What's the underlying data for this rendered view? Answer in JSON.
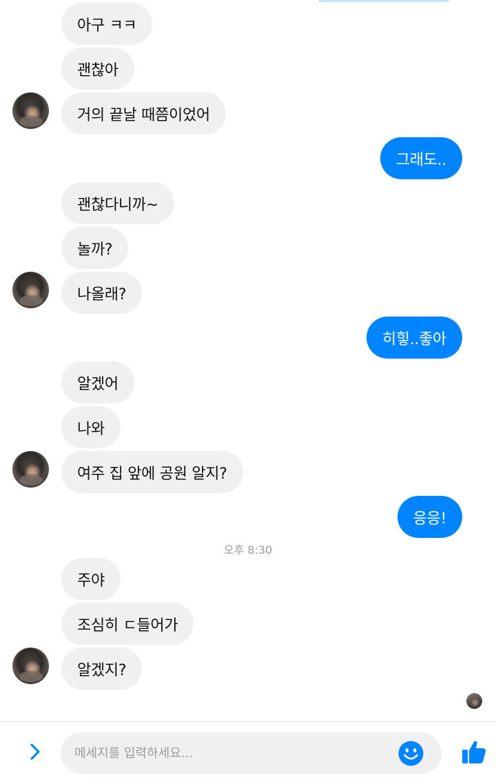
{
  "messages": [
    {
      "text": "아구 ㅋㅋ"
    },
    {
      "text": "괜찮아"
    },
    {
      "text": "거의 끝날 때쯤이었어"
    },
    {
      "text": "그래도.."
    },
    {
      "text": "괜찮다니까~"
    },
    {
      "text": "놀까?"
    },
    {
      "text": "나올래?"
    },
    {
      "text": "히힣..좋아"
    },
    {
      "text": "알겠어"
    },
    {
      "text": "나와"
    },
    {
      "text": "여주 집 앞에 공원 알지?"
    },
    {
      "text": "응응!"
    },
    {
      "text": "주야"
    },
    {
      "text": "조심히 ㄷ들어가"
    },
    {
      "text": "알겠지?"
    }
  ],
  "timestamp": "오후 8:30",
  "composer": {
    "placeholder": "메세지를 입력하세요...",
    "expand_icon": "chevron-right-icon",
    "emoji_icon": "smiley-icon",
    "like_icon": "thumbs-up-icon"
  },
  "colors": {
    "accent": "#0084ff",
    "incoming_bubble": "#f1f0f0",
    "background": "#ffffff"
  }
}
